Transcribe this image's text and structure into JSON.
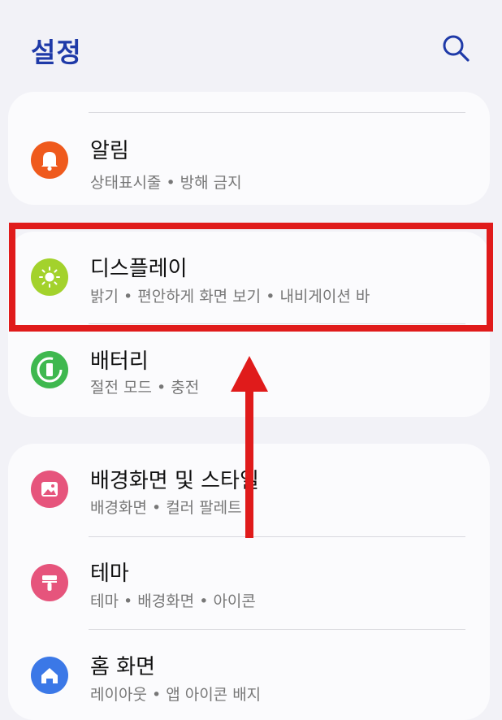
{
  "header": {
    "title": "설정"
  },
  "groups": [
    {
      "items": [
        {
          "label": "알림",
          "subtitle": "상태표시줄 • 방해 금지",
          "icon": "bell-icon",
          "color": "#ef5a1d"
        }
      ]
    },
    {
      "items": [
        {
          "label": "디스플레이",
          "subtitle": "밝기 • 편안하게 화면 보기 • 내비게이션 바",
          "icon": "brightness-icon",
          "color": "#a3d22c"
        },
        {
          "label": "배터리",
          "subtitle": "절전 모드 • 충전",
          "icon": "battery-icon",
          "color": "#3fb84f"
        }
      ]
    },
    {
      "items": [
        {
          "label": "배경화면 및 스타일",
          "subtitle": "배경화면 • 컬러 팔레트",
          "icon": "wallpaper-icon",
          "color": "#e6547c"
        },
        {
          "label": "테마",
          "subtitle": "테마 • 배경화면 • 아이콘",
          "icon": "paintbrush-icon",
          "color": "#e6547c"
        },
        {
          "label": "홈 화면",
          "subtitle": "레이아웃 • 앱 아이콘 배지",
          "icon": "home-icon",
          "color": "#3b78e7"
        }
      ]
    }
  ],
  "annotation": {
    "highlight_color": "#e01b1b"
  }
}
